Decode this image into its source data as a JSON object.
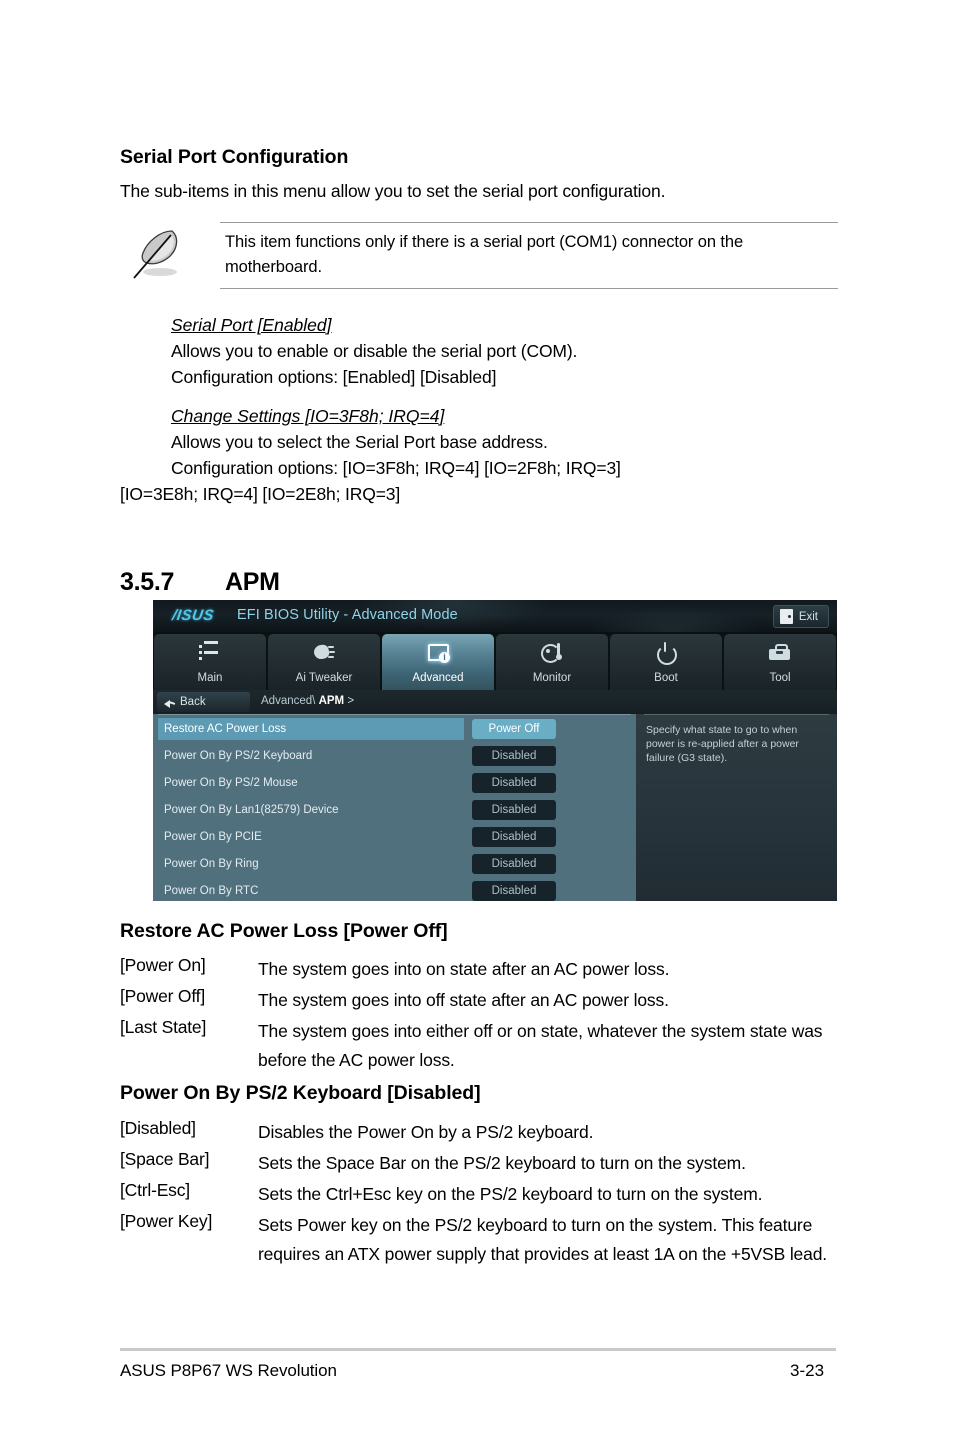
{
  "serial_section": {
    "heading": "Serial Port Configuration",
    "intro": "The sub-items in this menu allow you to set the serial port configuration.",
    "note": "This item functions only if there is a serial port (COM1) connector on the motherboard.",
    "items": [
      {
        "title": "Serial Port [Enabled]",
        "desc": "Allows you to enable or disable the serial port (COM).",
        "options": "Configuration options: [Enabled] [Disabled]"
      },
      {
        "title": "Change Settings [IO=3F8h; IRQ=4]",
        "desc": "Allows you to select the Serial Port base address.",
        "options": "Configuration options: [IO=3F8h; IRQ=4] [IO=2F8h; IRQ=3]",
        "options2": "[IO=3E8h; IRQ=4] [IO=2E8h; IRQ=3]"
      }
    ]
  },
  "apm_section": {
    "number": "3.5.7",
    "title": "APM"
  },
  "bios": {
    "logo": "/ISUS",
    "title": "EFI BIOS Utility - Advanced Mode",
    "exit_label": "Exit",
    "tabs": [
      {
        "label": "Main",
        "icon": "list-icon",
        "active": false
      },
      {
        "label": "Ai  Tweaker",
        "icon": "knob-icon",
        "active": false
      },
      {
        "label": "Advanced",
        "icon": "monitor-info-icon",
        "active": true
      },
      {
        "label": "Monitor",
        "icon": "gauge-thermometer-icon",
        "active": false
      },
      {
        "label": "Boot",
        "icon": "power-icon",
        "active": false
      },
      {
        "label": "Tool",
        "icon": "toolbox-icon",
        "active": false
      }
    ],
    "back_label": "Back",
    "breadcrumb_parent": "Advanced\\",
    "breadcrumb_current": "APM",
    "breadcrumb_sep": ">",
    "options": [
      {
        "label": "Restore AC Power Loss",
        "value": "Power Off",
        "selected": true
      },
      {
        "label": "Power On By PS/2 Keyboard",
        "value": "Disabled",
        "selected": false
      },
      {
        "label": "Power On By PS/2 Mouse",
        "value": "Disabled",
        "selected": false
      },
      {
        "label": "Power On By Lan1(82579) Device",
        "value": "Disabled",
        "selected": false
      },
      {
        "label": "Power On By PCIE",
        "value": "Disabled",
        "selected": false
      },
      {
        "label": "Power On By Ring",
        "value": "Disabled",
        "selected": false
      },
      {
        "label": "Power On By RTC",
        "value": "Disabled",
        "selected": false
      }
    ],
    "help_text": "Specify what state to go to when power is re-applied after a power failure (G3 state)."
  },
  "restore_section": {
    "heading": "Restore AC Power Loss [Power Off]",
    "rows": [
      {
        "term": "[Power On]",
        "desc": "The system goes into on state after an AC power loss."
      },
      {
        "term": "[Power Off]",
        "desc": "The system goes into off state after an AC power loss."
      },
      {
        "term": "[Last State]",
        "desc": "The system goes into either off or on state, whatever the system state was before the AC power loss."
      }
    ]
  },
  "ps2_section": {
    "heading": "Power On By PS/2 Keyboard [Disabled]",
    "rows": [
      {
        "term": "[Disabled]",
        "desc": "Disables the Power On by a PS/2 keyboard."
      },
      {
        "term": "[Space Bar]",
        "desc": "Sets the Space Bar on the PS/2 keyboard to turn on the system."
      },
      {
        "term": "[Ctrl-Esc]",
        "desc": "Sets the Ctrl+Esc key on the PS/2 keyboard to turn on the system."
      },
      {
        "term": "[Power Key]",
        "desc": "Sets Power key on the PS/2 keyboard to turn on the system. This feature requires an ATX power supply that provides at least 1A on the +5VSB lead."
      }
    ]
  },
  "footer": {
    "left": "ASUS P8P67 WS Revolution",
    "right": "3-23"
  }
}
